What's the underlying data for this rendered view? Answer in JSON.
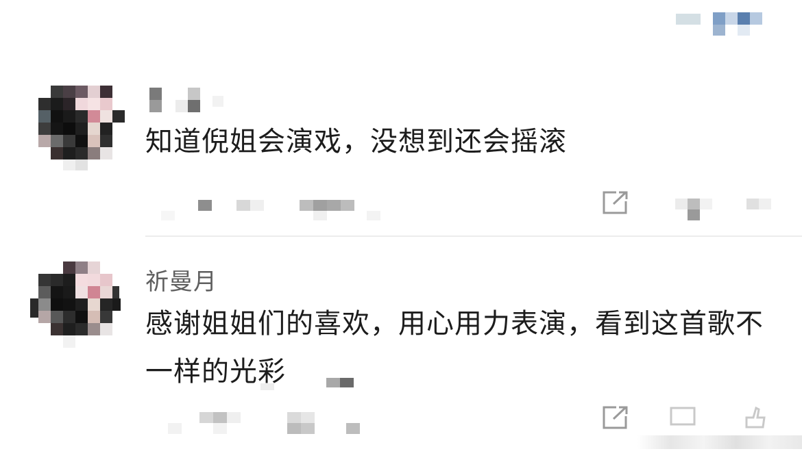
{
  "comments": [
    {
      "username": "",
      "text": "知道倪姐会演戏，没想到还会摇滚",
      "share_icon": "share-external-icon"
    },
    {
      "username": "祈曼月",
      "text": "感谢姐姐们的喜欢，用心用力表演，看到这首歌不一样的光彩",
      "share_icon": "share-external-icon"
    }
  ],
  "colors": {
    "username": "#5f5f5f",
    "text": "#1c1c1c",
    "divider": "#ececec",
    "icon": "#9a9a9a"
  }
}
